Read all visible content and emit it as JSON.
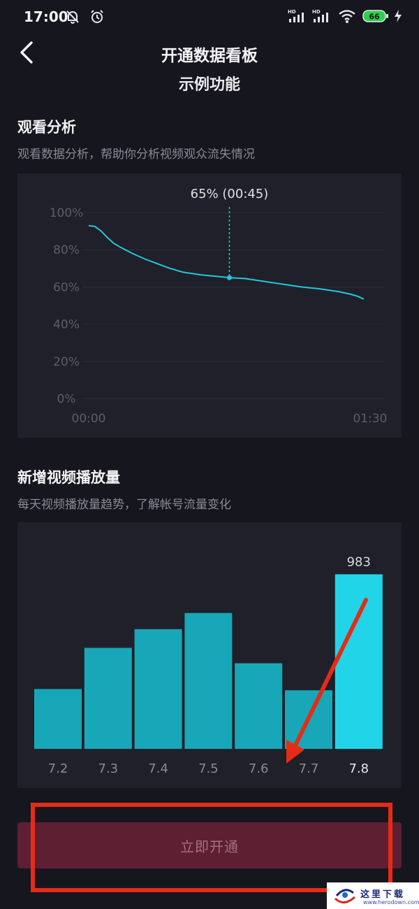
{
  "status_bar": {
    "time": "17:00",
    "battery": "66",
    "signal_tag": "HD"
  },
  "nav": {
    "title": "开通数据看板",
    "subtitle": "示例功能"
  },
  "watch_analysis": {
    "title": "观看分析",
    "description": "观看数据分析，帮助你分析视频观众流失情况",
    "marker_label": "65% (00:45)"
  },
  "new_views": {
    "title": "新增视频播放量",
    "description": "每天视频播放量趋势，了解帐号流量变化"
  },
  "cta": {
    "label": "立即开通"
  },
  "watermark": {
    "text": "这里下载",
    "url": "www.herodown.com"
  },
  "colors": {
    "accent_cyan": "#22d4e8",
    "bar_teal": "#17a7b8",
    "cta_bg": "#5e1f33",
    "annotation_red": "#e62b16"
  },
  "chart_data": [
    {
      "type": "line",
      "ylim": [
        0,
        100
      ],
      "yticks": [
        "0%",
        "20%",
        "40%",
        "60%",
        "80%",
        "100%"
      ],
      "xticks": [
        "00:00",
        "01:30"
      ],
      "xlim_seconds": [
        0,
        90
      ],
      "grid": true,
      "series": [
        {
          "x": [
            0,
            2,
            4,
            6,
            8,
            10,
            14,
            18,
            22,
            26,
            30,
            36,
            42,
            45,
            50,
            56,
            62,
            68,
            74,
            80,
            84,
            86,
            88
          ],
          "values": [
            93,
            92.5,
            90,
            86.5,
            83.5,
            81.5,
            78,
            75,
            72.5,
            70,
            68,
            66.5,
            65.5,
            65,
            64.5,
            63,
            61.5,
            60,
            59,
            57.5,
            56,
            55,
            53.5
          ]
        }
      ],
      "annotation": {
        "x": 45,
        "y": 65
      }
    },
    {
      "type": "bar",
      "categories": [
        "7.2",
        "7.3",
        "7.4",
        "7.5",
        "7.6",
        "7.7",
        "7.8"
      ],
      "values": [
        337,
        569,
        674,
        765,
        482,
        330,
        983
      ],
      "highlight_index": 6,
      "ylim": [
        0,
        1000
      ]
    }
  ]
}
